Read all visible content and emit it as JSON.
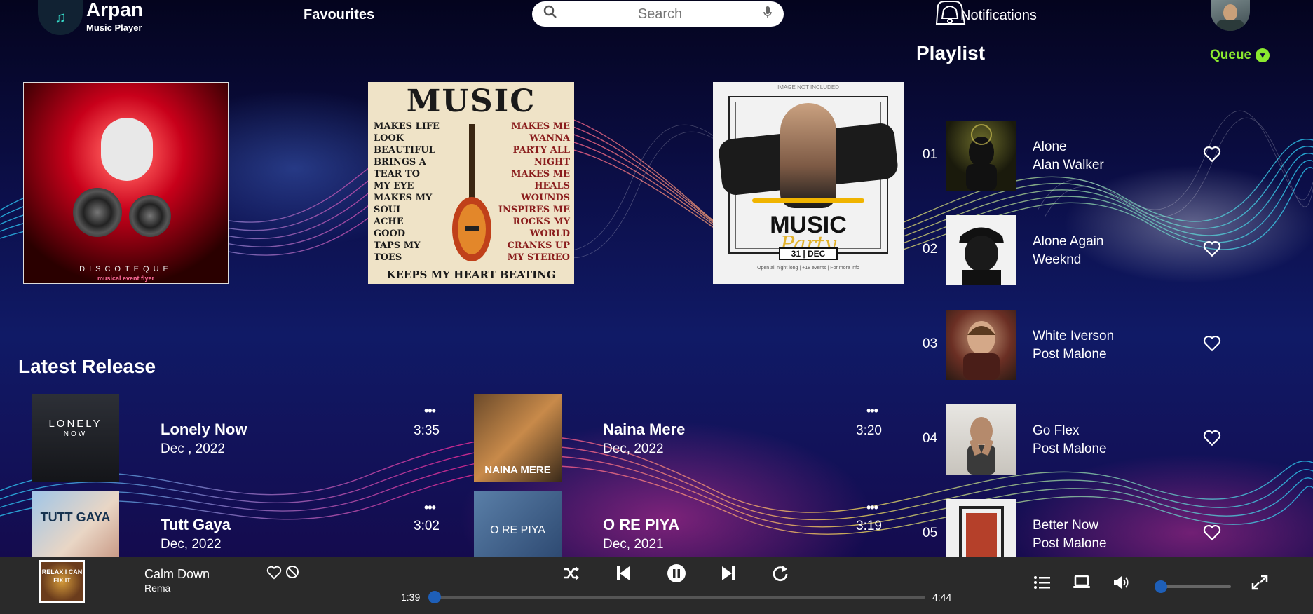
{
  "header": {
    "logo_text": "ARPAN",
    "brand_name": "Arpan",
    "brand_sub": "Music Player",
    "nav_favourites": "Favourites",
    "search_placeholder": "Search",
    "notifications_label": "Notifications"
  },
  "featured": [
    {
      "icon": "discoteque-poster",
      "title": "DISCOTEQUE",
      "subtitle": "musical event flyer"
    },
    {
      "icon": "music-guitar-poster",
      "title": "MUSIC",
      "left_words": [
        "MAKES LIFE",
        "LOOK BEAUTIFUL",
        "BRINGS A",
        "TEAR TO",
        "MY EYE",
        "MAKES MY",
        "SOUL",
        "ACHE",
        "GOOD",
        "TAPS MY",
        "TOES"
      ],
      "right_words": [
        "MAKES ME WANNA",
        "PARTY ALL NIGHT",
        "MAKES ME HEALS",
        "WOUNDS",
        "INSPIRES ME",
        "ROCKS MY WORLD",
        "CRANKS UP",
        "MY STEREO"
      ],
      "footer": "KEEPS MY HEART BEATING"
    },
    {
      "icon": "music-party-poster",
      "top_note": "IMAGE NOT INCLUDED",
      "title": "MUSIC",
      "script": "Party",
      "date": "31 | DEC",
      "small": "Open all night long | +18 events | For more info"
    }
  ],
  "latest_release": {
    "title": "Latest Release",
    "items": [
      {
        "title": "Lonely Now",
        "date": "Dec , 2022",
        "duration": "3:35",
        "more": "•••",
        "art_text": "LONELY",
        "art_sub": "NOW"
      },
      {
        "title": "Naina Mere",
        "date": "Dec, 2022",
        "duration": "3:20",
        "more": "•••",
        "art_text": "NAINA MERE"
      },
      {
        "title": "Tutt Gaya",
        "date": "Dec, 2022",
        "duration": "3:02",
        "more": "•••",
        "art_text": "TUTT GAYA"
      },
      {
        "title": "O RE PIYA",
        "date": "Dec, 2021",
        "duration": "3:19",
        "more": "•••",
        "art_text": "O RE PIYA"
      }
    ]
  },
  "playlist": {
    "title": "Playlist",
    "queue_label": "Queue",
    "items": [
      {
        "num": "01",
        "song": "Alone",
        "artist": "Alan Walker"
      },
      {
        "num": "02",
        "song": "Alone Again",
        "artist": "Weeknd"
      },
      {
        "num": "03",
        "song": "White Iverson",
        "artist": "Post Malone"
      },
      {
        "num": "04",
        "song": "Go Flex",
        "artist": "Post Malone"
      },
      {
        "num": "05",
        "song": "Better Now",
        "artist": "Post Malone"
      }
    ]
  },
  "player": {
    "art_text": "RELAX I CAN FIX IT",
    "title": "Calm Down",
    "artist": "Rema",
    "elapsed": "1:39",
    "total": "4:44",
    "progress": 0.0,
    "volume": 0.0,
    "accent_color": "#1e5fb8"
  },
  "colors": {
    "queue": "#8bea2f",
    "accent": "#1e6fd6"
  }
}
